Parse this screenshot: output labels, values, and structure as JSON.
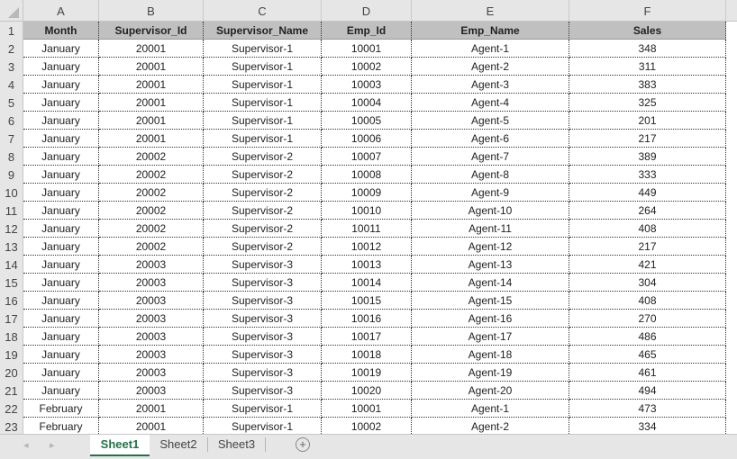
{
  "columns": [
    "A",
    "B",
    "C",
    "D",
    "E",
    "F"
  ],
  "header_row": [
    "Month",
    "Supervisor_Id",
    "Supervisor_Name",
    "Emp_Id",
    "Emp_Name",
    "Sales"
  ],
  "rows": [
    [
      "January",
      "20001",
      "Supervisor-1",
      "10001",
      "Agent-1",
      "348"
    ],
    [
      "January",
      "20001",
      "Supervisor-1",
      "10002",
      "Agent-2",
      "311"
    ],
    [
      "January",
      "20001",
      "Supervisor-1",
      "10003",
      "Agent-3",
      "383"
    ],
    [
      "January",
      "20001",
      "Supervisor-1",
      "10004",
      "Agent-4",
      "325"
    ],
    [
      "January",
      "20001",
      "Supervisor-1",
      "10005",
      "Agent-5",
      "201"
    ],
    [
      "January",
      "20001",
      "Supervisor-1",
      "10006",
      "Agent-6",
      "217"
    ],
    [
      "January",
      "20002",
      "Supervisor-2",
      "10007",
      "Agent-7",
      "389"
    ],
    [
      "January",
      "20002",
      "Supervisor-2",
      "10008",
      "Agent-8",
      "333"
    ],
    [
      "January",
      "20002",
      "Supervisor-2",
      "10009",
      "Agent-9",
      "449"
    ],
    [
      "January",
      "20002",
      "Supervisor-2",
      "10010",
      "Agent-10",
      "264"
    ],
    [
      "January",
      "20002",
      "Supervisor-2",
      "10011",
      "Agent-11",
      "408"
    ],
    [
      "January",
      "20002",
      "Supervisor-2",
      "10012",
      "Agent-12",
      "217"
    ],
    [
      "January",
      "20003",
      "Supervisor-3",
      "10013",
      "Agent-13",
      "421"
    ],
    [
      "January",
      "20003",
      "Supervisor-3",
      "10014",
      "Agent-14",
      "304"
    ],
    [
      "January",
      "20003",
      "Supervisor-3",
      "10015",
      "Agent-15",
      "408"
    ],
    [
      "January",
      "20003",
      "Supervisor-3",
      "10016",
      "Agent-16",
      "270"
    ],
    [
      "January",
      "20003",
      "Supervisor-3",
      "10017",
      "Agent-17",
      "486"
    ],
    [
      "January",
      "20003",
      "Supervisor-3",
      "10018",
      "Agent-18",
      "465"
    ],
    [
      "January",
      "20003",
      "Supervisor-3",
      "10019",
      "Agent-19",
      "461"
    ],
    [
      "January",
      "20003",
      "Supervisor-3",
      "10020",
      "Agent-20",
      "494"
    ],
    [
      "February",
      "20001",
      "Supervisor-1",
      "10001",
      "Agent-1",
      "473"
    ],
    [
      "February",
      "20001",
      "Supervisor-1",
      "10002",
      "Agent-2",
      "334"
    ]
  ],
  "row_numbers": [
    "1",
    "2",
    "3",
    "4",
    "5",
    "6",
    "7",
    "8",
    "9",
    "10",
    "11",
    "12",
    "13",
    "14",
    "15",
    "16",
    "17",
    "18",
    "19",
    "20",
    "21",
    "22",
    "23"
  ],
  "sheet_tabs": [
    {
      "label": "Sheet1",
      "active": true
    },
    {
      "label": "Sheet2",
      "active": false
    },
    {
      "label": "Sheet3",
      "active": false
    }
  ],
  "nav": {
    "prev": "◂",
    "next": "▸",
    "add": "+"
  },
  "colors": {
    "accent": "#217346",
    "header_fill": "#c0c0c0",
    "chrome": "#e6e6e6"
  }
}
